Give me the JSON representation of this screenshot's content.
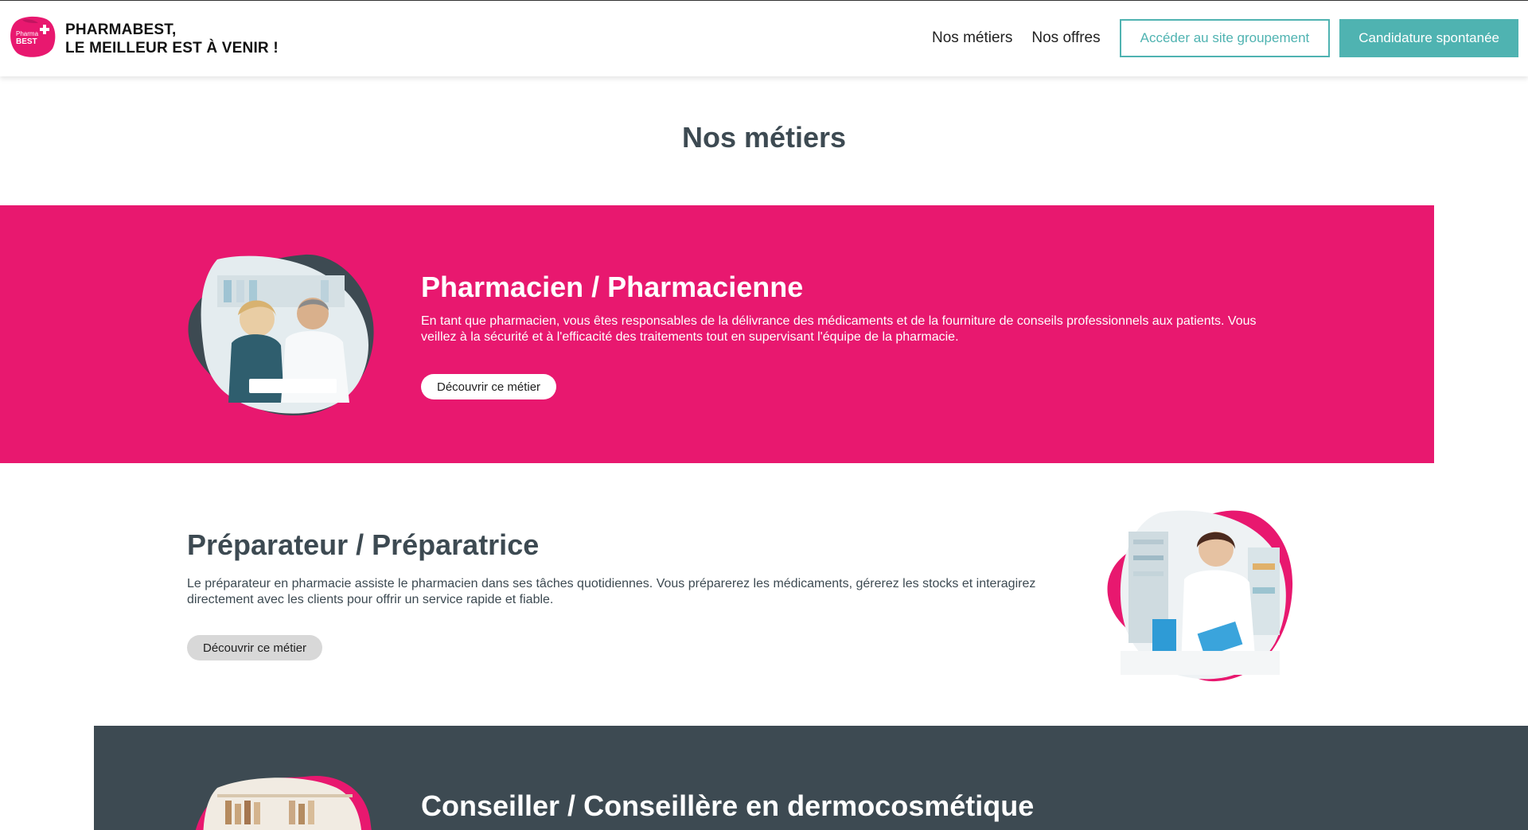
{
  "header": {
    "logo_text_top": "Pharma",
    "logo_text_bottom": "BEST",
    "brand_line1": "PHARMABEST,",
    "brand_line2": "LE MEILLEUR EST À VENIR !",
    "nav": [
      "Nos métiers",
      "Nos offres"
    ],
    "btn_groupement": "Accéder au site groupement",
    "btn_candidature": "Candidature spontanée"
  },
  "main": {
    "title": "Nos métiers",
    "jobs": [
      {
        "title": "Pharmacien / Pharmacienne",
        "description": "En tant que pharmacien, vous êtes responsables de la délivrance des médicaments et de la fourniture de conseils professionnels aux patients. Vous veillez à la sécurité et à l'efficacité des traitements tout en supervisant l'équipe de la pharmacie.",
        "button": "Découvrir ce métier"
      },
      {
        "title": "Préparateur / Préparatrice",
        "description": "Le préparateur en pharmacie assiste le pharmacien dans ses tâches quotidiennes. Vous préparerez les médicaments, gérerez les stocks et interagirez directement avec les clients pour offrir un service rapide et fiable.",
        "button": "Découvrir ce métier"
      },
      {
        "title": "Conseiller / Conseillère en dermocosmétique"
      }
    ]
  },
  "colors": {
    "brand_pink": "#e8186f",
    "teal": "#4fb3b1",
    "dark_slate": "#3d4a52"
  }
}
